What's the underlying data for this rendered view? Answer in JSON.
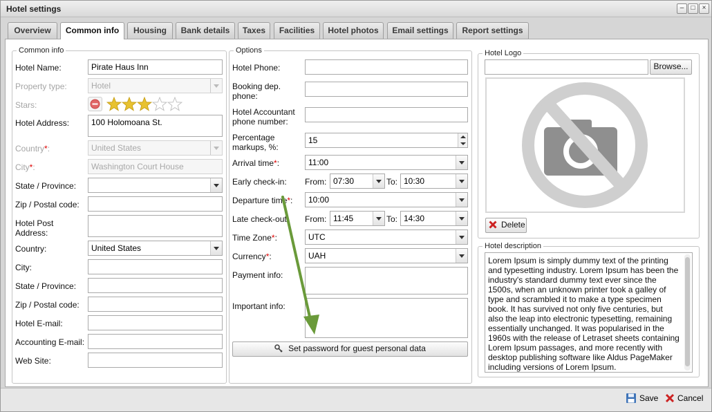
{
  "window": {
    "title": "Hotel settings",
    "minimize": "–",
    "maximize": "□",
    "close": "×"
  },
  "tabs": [
    {
      "label": "Overview"
    },
    {
      "label": "Common info"
    },
    {
      "label": "Housing"
    },
    {
      "label": "Bank details"
    },
    {
      "label": "Taxes"
    },
    {
      "label": "Facilities"
    },
    {
      "label": "Hotel photos"
    },
    {
      "label": "Email settings"
    },
    {
      "label": "Report settings"
    }
  ],
  "common": {
    "legend": "Common info",
    "hotel_name_label": "Hotel Name:",
    "hotel_name": "Pirate Haus Inn",
    "property_type_label": "Property type:",
    "property_type": "Hotel",
    "stars_label": "Stars:",
    "stars": 3,
    "stars_max": 5,
    "address_label": "Hotel Address:",
    "address": "100 Holomoana St.",
    "country_label": "Country",
    "country": "United States",
    "city_label": "City",
    "city": "Washington Court House",
    "state_label": "State / Province:",
    "state": "",
    "zip_label": "Zip / Postal code:",
    "zip": "",
    "post_label1": "Hotel Post",
    "post_label2": "Address:",
    "post": "",
    "country2_label": "Country:",
    "country2": "United States",
    "city2_label": "City:",
    "city2": "",
    "state2_label": "State / Province:",
    "state2": "",
    "zip2_label": "Zip / Postal code:",
    "zip2": "",
    "email_label": "Hotel E-mail:",
    "email": "",
    "acc_email_label": "Accounting E-mail:",
    "acc_email": "",
    "website_label": "Web Site:",
    "website": ""
  },
  "options": {
    "legend": "Options",
    "phone_label": "Hotel Phone:",
    "phone": "",
    "booking_label1": "Booking dep.",
    "booking_label2": "phone:",
    "booking": "",
    "accountant_label1": "Hotel Accountant",
    "accountant_label2": "phone number:",
    "accountant": "",
    "markup_label1": "Percentage",
    "markup_label2": "markups, %:",
    "markup": "15",
    "arrival_label": "Arrival time",
    "arrival": "11:00",
    "early_label": "Early check-in:",
    "early_from_label": "From:",
    "early_from": "07:30",
    "early_to_label": "To:",
    "early_to": "10:30",
    "departure_label": "Departure time",
    "departure": "10:00",
    "late_label": "Late check-out:",
    "late_from_label": "From:",
    "late_from": "11:45",
    "late_to_label": "To:",
    "late_to": "14:30",
    "timezone_label": "Time Zone",
    "timezone": "UTC",
    "currency_label": "Currency",
    "currency": "UAH",
    "payment_label": "Payment info:",
    "payment": "",
    "important_label": "Important info:",
    "important": "",
    "password_button": "Set password for guest personal data"
  },
  "logo": {
    "legend": "Hotel Logo",
    "file": "",
    "browse": "Browse...",
    "delete": "Delete"
  },
  "description": {
    "legend": "Hotel description",
    "text": "Lorem Ipsum is simply dummy text of the printing and typesetting industry. Lorem Ipsum has been the industry's standard dummy text ever since the 1500s, when an unknown printer took a galley of type and scrambled it to make a type specimen book. It has survived not only five centuries, but also the leap into electronic typesetting, remaining essentially unchanged. It was popularised in the 1960s with the release of Letraset sheets containing Lorem Ipsum passages, and more recently with desktop publishing software like Aldus PageMaker including versions of Lorem Ipsum."
  },
  "footer": {
    "save": "Save",
    "cancel": "Cancel"
  },
  "colors": {
    "annotation_arrow": "#6a9a3a",
    "required": "#dd0000",
    "star": "#e8c230"
  },
  "icons": [
    "minimize-icon",
    "maximize-icon",
    "close-icon",
    "remove-icon",
    "star-icon",
    "key-icon",
    "no-photo-icon",
    "delete-icon",
    "save-icon",
    "cancel-icon",
    "arrow-annotation"
  ]
}
